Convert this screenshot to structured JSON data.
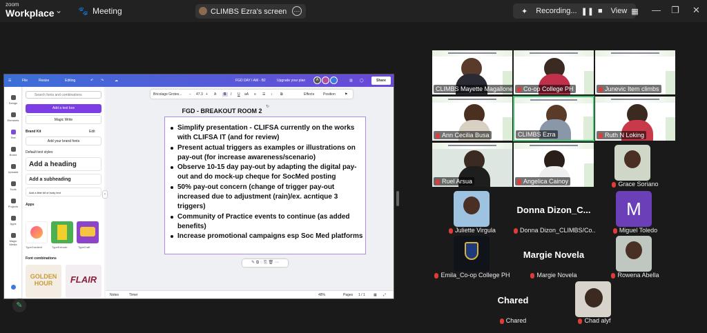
{
  "app": {
    "brand_top": "zoom",
    "brand_bottom": "Workplace",
    "meeting_label": "Meeting"
  },
  "screen_pill": {
    "label": "CLIMBS Ezra's screen"
  },
  "recording": {
    "label": "Recording...",
    "view_label": "View"
  },
  "canva": {
    "topbar": {
      "file": "File",
      "resize": "Resize",
      "editing": "Editing",
      "doc_title": "FGD DAY I AM - B2",
      "upgrade": "Upgrade your plan",
      "share": "Share",
      "avatar_a": "A"
    },
    "rail": [
      "Design",
      "Elements",
      "Text",
      "Brand",
      "Uploads",
      "Tools",
      "Projects",
      "Apps",
      "Magic Media"
    ],
    "panel": {
      "search_placeholder": "Search fonts and combinations",
      "add_text_box": "Add a text box",
      "magic_write": "Magic Write",
      "brand_kit": "Brand Kit",
      "edit": "Edit",
      "add_brand_fonts": "Add your brand fonts",
      "default_styles": "Default text styles",
      "add_heading": "Add a heading",
      "add_subheading": "Add a subheading",
      "add_body": "Add a little bit of body text",
      "apps": "Apps",
      "app_names": [
        "TypeGradient",
        "TypeExtrude",
        "TypeCraft"
      ],
      "font_combinations": "Font combinations",
      "combo1": "GOLDEN HOUR",
      "combo2": "FLAIR"
    },
    "toolbar": {
      "font": "Bricolage Grotes...",
      "minus": "−",
      "size": "47.3",
      "plus": "+",
      "bold": "B",
      "effects": "Effects",
      "position": "Position"
    },
    "slide": {
      "title": "FGD - BREAKOUT ROOM 2",
      "bullets": [
        "Simplify presentation - CLIFSA currently on the works with CLIFSA IT (and for review)",
        "Present actual triggers as examples or illustrations on pay-out (for increase awareness/scenario)",
        "Observe 10-15 day pay-out by adapting the digital pay-out and do mock-up cheque for SocMed posting",
        "50% pay-out concern (change of trigger pay-out increased due to adjustment (rain)/ex. acntique 3 triggers)",
        "Community of Practice events to continue (as added benefits)",
        "Increase promotional campaigns esp Soc Med platforms"
      ]
    },
    "bottom": {
      "notes": "Notes",
      "timer": "Timer",
      "zoom": "48%",
      "pages": "Pages",
      "page_count": "1 / 1"
    }
  },
  "participants": {
    "video": [
      "CLIMBS Mayette Magallones",
      "Co-op College PH",
      "Junevic Item climbs",
      "Ann Cecilia Busa",
      "CLIMBS Ezra",
      "Ruth N Loking",
      "Ruel Arsua",
      "Angelica Cainoy",
      "Grace Soriano"
    ],
    "row2": [
      {
        "label": "Juliette Virgula"
      },
      {
        "big": "Donna  Dizon_C...",
        "label": "Donna Dizon_CLIMBS/Co..."
      },
      {
        "label": "Miguel Toledo",
        "initial": "M"
      }
    ],
    "row3": [
      {
        "label": "Emila_Co-op College PH"
      },
      {
        "big": "Margie Novela",
        "label": "Margie Novela"
      },
      {
        "label": "Rowena Abella"
      }
    ],
    "row4": [
      {
        "big": "Chared",
        "label": "Chared"
      },
      {
        "label": "Chad alyf"
      }
    ]
  }
}
